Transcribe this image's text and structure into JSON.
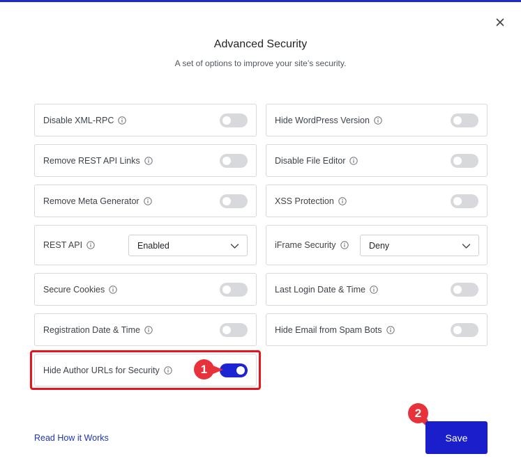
{
  "dialog": {
    "title": "Advanced Security",
    "subtitle": "A set of options to improve your site’s security."
  },
  "options": {
    "disable_xmlrpc": {
      "label": "Disable XML-RPC",
      "enabled": false
    },
    "hide_wp_version": {
      "label": "Hide WordPress Version",
      "enabled": false
    },
    "remove_rest_links": {
      "label": "Remove REST API Links",
      "enabled": false
    },
    "disable_file_editor": {
      "label": "Disable File Editor",
      "enabled": false
    },
    "remove_meta_generator": {
      "label": "Remove Meta Generator",
      "enabled": false
    },
    "xss_protection": {
      "label": "XSS Protection",
      "enabled": false
    },
    "rest_api": {
      "label": "REST API",
      "value": "Enabled"
    },
    "iframe_security": {
      "label": "iFrame Security",
      "value": "Deny"
    },
    "secure_cookies": {
      "label": "Secure Cookies",
      "enabled": false
    },
    "last_login": {
      "label": "Last Login Date & Time",
      "enabled": false
    },
    "registration_date": {
      "label": "Registration Date & Time",
      "enabled": false
    },
    "hide_email": {
      "label": "Hide Email from Spam Bots",
      "enabled": false
    },
    "hide_author_urls": {
      "label": "Hide Author URLs for Security",
      "enabled": true
    }
  },
  "annotations": {
    "badge_1": "1",
    "badge_2": "2",
    "badge_color": "#e8323b",
    "highlight_color": "#e8141c"
  },
  "footer": {
    "read_link": "Read How it Works",
    "save_label": "Save"
  },
  "colors": {
    "accent": "#1a1fcb",
    "toggle_off": "#d8d9dc",
    "toggle_on": "#1d24d1"
  },
  "icons": {
    "close": "close-icon",
    "info": "info-icon",
    "dropdown": "chevron-down-icon"
  }
}
